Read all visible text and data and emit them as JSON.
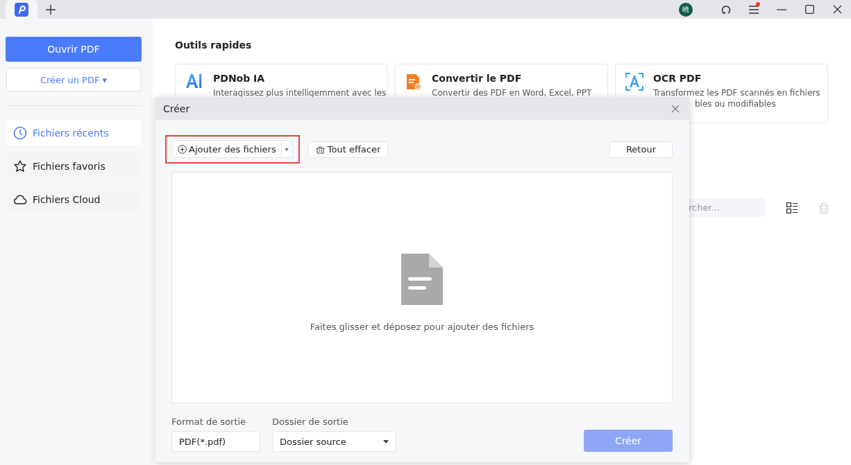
{
  "titlebar": {
    "avatar": "曉",
    "menu_badge": true
  },
  "sidebar": {
    "open_button": "Ouvrir PDF",
    "create_button": "Créer un PDF ▾",
    "items": [
      {
        "label": "Fichiers récents",
        "selected": true
      },
      {
        "label": "Fichiers favoris",
        "selected": false
      },
      {
        "label": "Fichiers Cloud",
        "selected": false
      }
    ]
  },
  "main": {
    "section_title": "Outils rapides",
    "tools": [
      {
        "title": "PDNob IA",
        "lines": [
          "Interagissez plus intelligemment avec les"
        ]
      },
      {
        "title": "Convertir le PDF",
        "lines": [
          "Convertir des PDF en Word, Excel, PPT"
        ]
      },
      {
        "title": "OCR PDF",
        "lines": [
          "Transformez les PDF scannés en fichiers",
          "bles ou modifiables"
        ]
      }
    ],
    "search": {
      "placeholder": "rcher..."
    }
  },
  "dialog": {
    "title": "Créer",
    "add_button": "Ajouter des fichiers",
    "add_highlighted": true,
    "clear_button": "Tout effacer",
    "back_button": "Retour",
    "drop_hint": "Faites glisser et déposez pour ajouter des fichiers",
    "format": {
      "label": "Format de sortie",
      "value": "PDF(*.pdf)"
    },
    "folder": {
      "label": "Dossier de sortie",
      "value": "Dossier source"
    },
    "create_button": "Créer",
    "create_disabled": true
  }
}
